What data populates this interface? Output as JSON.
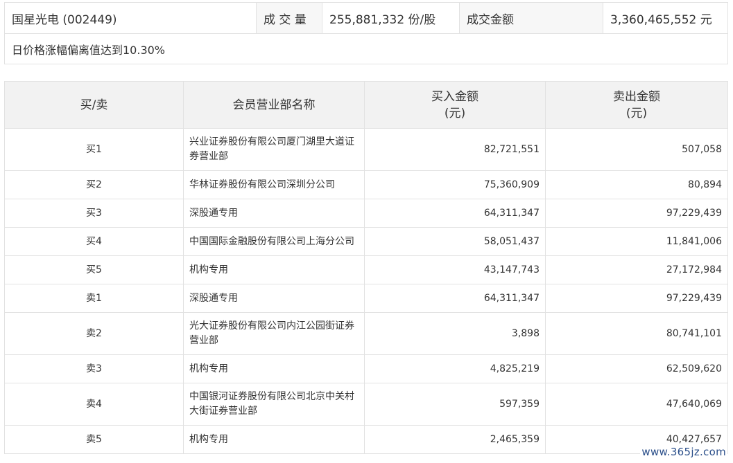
{
  "summary": {
    "stock_name": "国星光电 (002449)",
    "volume_label": "成 交 量",
    "volume_value": "255,881,332 份/股",
    "amount_label": "成交金额",
    "amount_value": "3,360,465,552 元",
    "note": "日价格涨幅偏离值达到10.30%"
  },
  "table": {
    "headers": {
      "side": "买/卖",
      "member": "会员营业部名称",
      "buy_line1": "买入金额",
      "buy_line2": "(元)",
      "sell_line1": "卖出金额",
      "sell_line2": "(元)"
    },
    "rows": [
      {
        "side": "买1",
        "name": "兴业证券股份有限公司厦门湖里大道证券营业部",
        "buy": "82,721,551",
        "sell": "507,058"
      },
      {
        "side": "买2",
        "name": "华林证券股份有限公司深圳分公司",
        "buy": "75,360,909",
        "sell": "80,894"
      },
      {
        "side": "买3",
        "name": "深股通专用",
        "buy": "64,311,347",
        "sell": "97,229,439"
      },
      {
        "side": "买4",
        "name": "中国国际金融股份有限公司上海分公司",
        "buy": "58,051,437",
        "sell": "11,841,006"
      },
      {
        "side": "买5",
        "name": "机构专用",
        "buy": "43,147,743",
        "sell": "27,172,984"
      },
      {
        "side": "卖1",
        "name": "深股通专用",
        "buy": "64,311,347",
        "sell": "97,229,439"
      },
      {
        "side": "卖2",
        "name": "光大证券股份有限公司内江公园街证券营业部",
        "buy": "3,898",
        "sell": "80,741,101"
      },
      {
        "side": "卖3",
        "name": "机构专用",
        "buy": "4,825,219",
        "sell": "62,509,620"
      },
      {
        "side": "卖4",
        "name": "中国银河证券股份有限公司北京中关村大街证券营业部",
        "buy": "597,359",
        "sell": "47,640,069"
      },
      {
        "side": "卖5",
        "name": "机构专用",
        "buy": "2,465,359",
        "sell": "40,427,657"
      }
    ]
  },
  "watermark": "www.365jz.com"
}
